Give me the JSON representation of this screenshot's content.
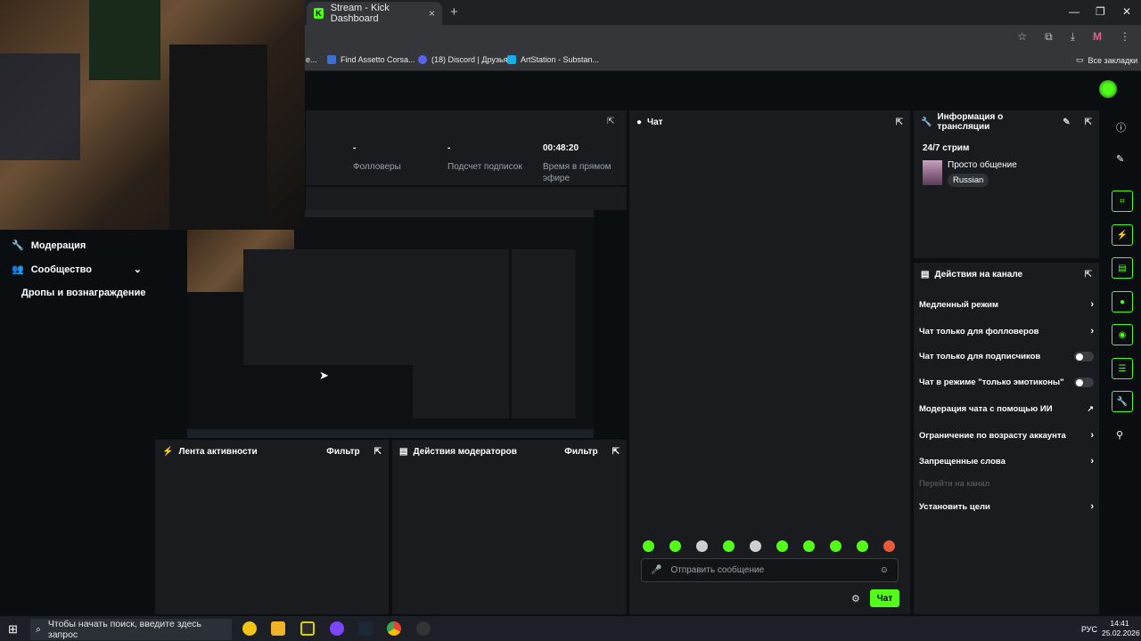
{
  "browser": {
    "tab_title": "Stream - Kick Dashboard",
    "tab_close": "×",
    "new_tab": "+",
    "window_controls": [
      "—",
      "❐",
      "✕"
    ],
    "bookmarks": [
      {
        "label": "Find Assetto Corsa...",
        "color": "#3b6fd6"
      },
      {
        "label": "(18) Discord | Друзья",
        "color": "#5865f2"
      },
      {
        "label": "ArtStation - Substan...",
        "color": "#13aff0"
      }
    ],
    "bookmark_prefix": "e...",
    "all_bookmarks": "Все закладки"
  },
  "stats": {
    "followers": {
      "value": "-",
      "label": "Фолловеры"
    },
    "subs": {
      "value": "-",
      "label": "Подсчет подписок"
    },
    "airtime": {
      "value": "00:48:20",
      "label": "Время в прямом эфире"
    }
  },
  "sidebar": {
    "moderation": "Модерация",
    "community": "Сообщество",
    "drops": "Дропы и вознаграждение"
  },
  "chat": {
    "title": "Чат",
    "placeholder": "Отправить сообщение",
    "send_label": "Чат"
  },
  "stream_info": {
    "title": "Информация о трансляции",
    "stream_name": "24/7 стрим",
    "category": "Просто общение",
    "language": "Russian"
  },
  "channel_actions": {
    "title": "Действия на канале",
    "items": [
      {
        "label": "Медленный режим",
        "control": "chevron"
      },
      {
        "label": "Чат только для фолловеров",
        "control": "chevron"
      },
      {
        "label": "Чат только для подписчиков",
        "control": "toggle"
      },
      {
        "label": "Чат в режиме \"только эмотиконы\"",
        "control": "toggle"
      },
      {
        "label": "Модерация чата с помощью ИИ",
        "control": "external"
      },
      {
        "label": "Ограничение по возрасту аккаунта",
        "control": "chevron"
      },
      {
        "label": "Запрещенные слова",
        "control": "chevron"
      },
      {
        "label": "Перейти на канал",
        "control": "none",
        "disabled": true
      },
      {
        "label": "Установить цели",
        "control": "chevron"
      }
    ]
  },
  "activity_feed": {
    "title": "Лента активности",
    "filter": "Фильтр"
  },
  "mod_actions": {
    "title": "Действия модераторов",
    "filter": "Фильтр"
  },
  "taskbar": {
    "search_placeholder": "Чтобы начать поиск, введите здесь запрос",
    "lang": "РУС",
    "time": "14:41",
    "date": "25.02.2026"
  },
  "colors": {
    "accent": "#53fc18",
    "panel": "#191b1f",
    "bg": "#0b0e11"
  }
}
